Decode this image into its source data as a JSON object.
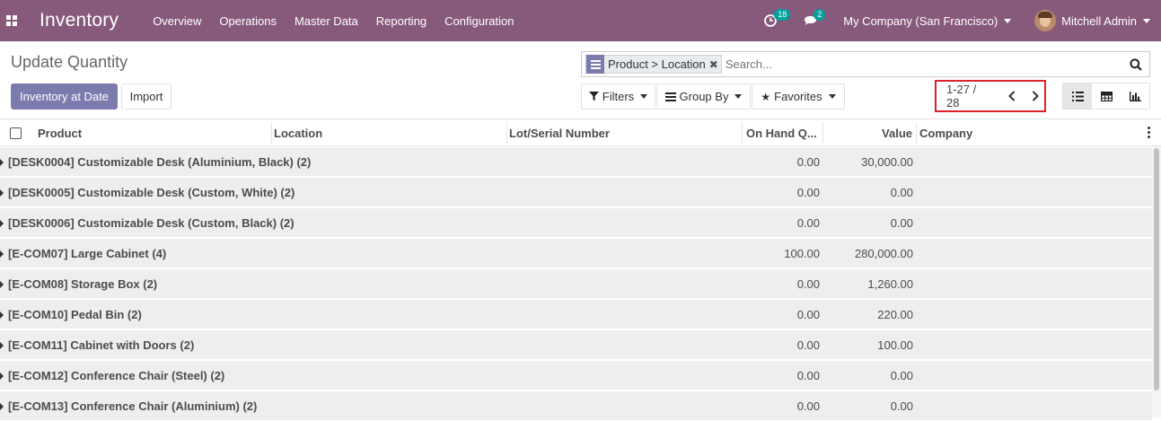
{
  "navbar": {
    "app_title": "Inventory",
    "menu": [
      "Overview",
      "Operations",
      "Master Data",
      "Reporting",
      "Configuration"
    ],
    "activity_count": "18",
    "message_count": "2",
    "company": "My Company (San Francisco)",
    "user": "Mitchell Admin",
    "color": "#875a7b"
  },
  "control": {
    "breadcrumb": "Update Quantity",
    "primary_button": "Inventory at Date",
    "import_button": "Import",
    "search": {
      "facet": "Product > Location",
      "placeholder": "Search..."
    },
    "filters": "Filters",
    "group_by": "Group By",
    "favorites": "Favorites",
    "pager": "1-27 / 28"
  },
  "table": {
    "columns": [
      "Product",
      "Location",
      "Lot/Serial Number",
      "On Hand Q...",
      "Value",
      "Company"
    ],
    "groups": [
      {
        "label": "[DESK0004] Customizable Desk (Aluminium, Black) (2)",
        "qty": "0.00",
        "value": "30,000.00"
      },
      {
        "label": "[DESK0005] Customizable Desk (Custom, White) (2)",
        "qty": "0.00",
        "value": "0.00"
      },
      {
        "label": "[DESK0006] Customizable Desk (Custom, Black) (2)",
        "qty": "0.00",
        "value": "0.00"
      },
      {
        "label": "[E-COM07] Large Cabinet (4)",
        "qty": "100.00",
        "value": "280,000.00"
      },
      {
        "label": "[E-COM08] Storage Box (2)",
        "qty": "0.00",
        "value": "1,260.00"
      },
      {
        "label": "[E-COM10] Pedal Bin (2)",
        "qty": "0.00",
        "value": "220.00"
      },
      {
        "label": "[E-COM11] Cabinet with Doors (2)",
        "qty": "0.00",
        "value": "100.00"
      },
      {
        "label": "[E-COM12] Conference Chair (Steel) (2)",
        "qty": "0.00",
        "value": "0.00"
      },
      {
        "label": "[E-COM13] Conference Chair (Aluminium) (2)",
        "qty": "0.00",
        "value": "0.00"
      }
    ]
  }
}
